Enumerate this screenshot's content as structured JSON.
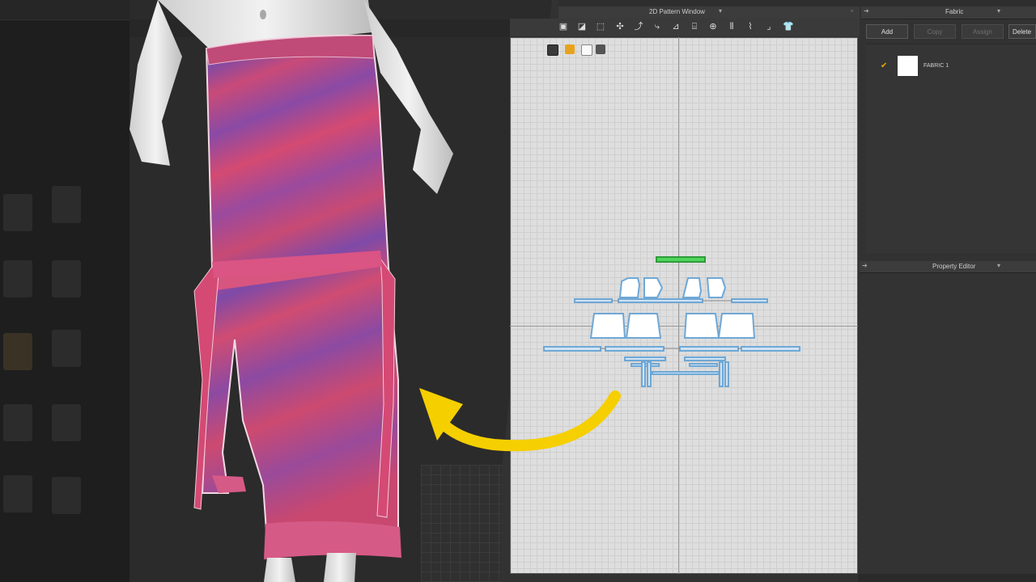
{
  "pattern_window": {
    "title": "2D Pattern Window"
  },
  "fabric_panel": {
    "title": "Fabric",
    "buttons": {
      "add": "Add",
      "copy": "Copy",
      "assign": "Assign",
      "delete": "Delete U"
    },
    "items": [
      {
        "name": "FABRIC 1",
        "checked": true,
        "swatch_color": "#ffffff"
      }
    ]
  },
  "property_editor": {
    "title": "Property Editor"
  },
  "colors": {
    "accent_arrow": "#f5cf00",
    "garment_pink": "#c94a78",
    "garment_purple": "#7a4aa8",
    "pattern_outline": "#6fa8d6",
    "selected_pattern": "#36c24a"
  },
  "icons": [
    "pin-icon",
    "dropdown-icon",
    "maximize-icon",
    "check-icon"
  ]
}
